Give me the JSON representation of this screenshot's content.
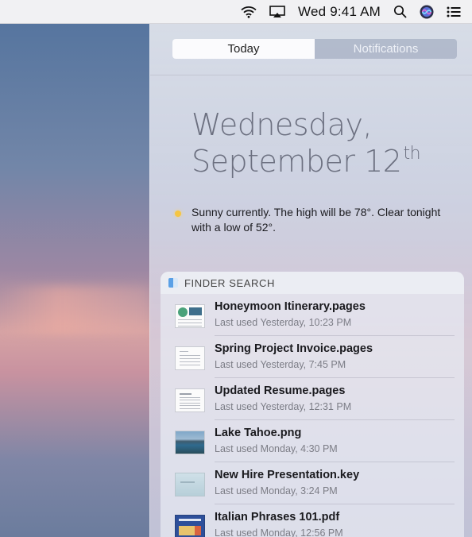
{
  "menubar": {
    "clock": "Wed 9:41 AM",
    "icons": [
      "wifi-icon",
      "airplay-icon",
      "search-icon",
      "siri-icon",
      "notification-center-icon"
    ]
  },
  "notification_center": {
    "tabs": [
      {
        "label": "Today",
        "active": true
      },
      {
        "label": "Notifications",
        "active": false
      }
    ],
    "date_line1": "Wednesday,",
    "date_line2": "September 12",
    "date_suffix": "th",
    "weather": "Sunny currently. The high will be 78°.  Clear tonight with a low of 52°.",
    "finder_search": {
      "title": "FINDER SEARCH",
      "items": [
        {
          "name": "Honeymoon Itinerary.pages",
          "meta": "Last used Yesterday, 10:23 PM",
          "thumb": "pages-doc-with-photos"
        },
        {
          "name": "Spring Project Invoice.pages",
          "meta": "Last used Yesterday, 7:45 PM",
          "thumb": "pages-doc"
        },
        {
          "name": "Updated Resume.pages",
          "meta": "Last used Yesterday, 12:31 PM",
          "thumb": "pages-doc"
        },
        {
          "name": "Lake Tahoe.png",
          "meta": "Last used Monday, 4:30 PM",
          "thumb": "lake-photo"
        },
        {
          "name": "New Hire Presentation.key",
          "meta": "Last used Monday, 3:24 PM",
          "thumb": "keynote-slide"
        },
        {
          "name": "Italian Phrases 101.pdf",
          "meta": "Last used Monday, 12:56 PM",
          "thumb": "pdf-doc"
        }
      ]
    }
  }
}
